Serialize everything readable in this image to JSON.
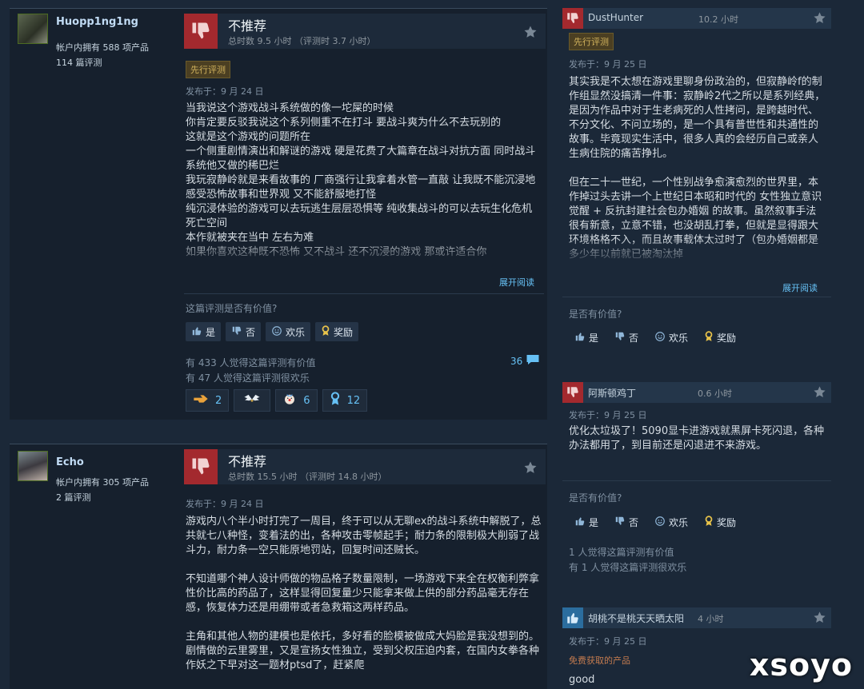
{
  "reviews_left": [
    {
      "author": {
        "name": "Huopp1ng1ng",
        "products": "帐户内拥有 588 项产品",
        "reviews": "114 篇评测"
      },
      "verdict": "不推荐",
      "hours": "总时数 9.5 小时 （评测时 3.7 小时）",
      "badge": "先行评测",
      "posted": "发布于：9 月 24 日",
      "text": "当我说这个游戏战斗系统做的像一坨屎的时候\n你肯定要反驳我说这个系列侧重不在打斗 要战斗爽为什么不去玩别的\n这就是这个游戏的问题所在\n一个侧重剧情演出和解谜的游戏 硬是花费了大篇章在战斗对抗方面 同时战斗系统他又做的稀巴烂\n我玩寂静岭就是来看故事的 厂商强行让我拿着水管一直敲 让我既不能沉浸地感受恐怖故事和世界观 又不能舒服地打怪\n纯沉浸体验的游戏可以去玩逃生层层恐惧等 纯收集战斗的可以去玩生化危机死亡空间\n本作就被夹在当中 左右为难\n如果你喜欢这种既不恐怖 又不战斗 还不沉浸的游戏 那或许适合你",
      "read_more": "展开阅读",
      "helpful_q": "这篇评测是否有价值?",
      "btn_yes": "是",
      "btn_no": "否",
      "btn_funny": "欢乐",
      "btn_award": "奖励",
      "stat_helpful": "有 433 人觉得这篇评测有价值",
      "stat_funny": "有 47 人觉得这篇评测很欢乐",
      "comments": "36",
      "awards": [
        {
          "icon": "hand-point-icon",
          "count": "2"
        },
        {
          "icon": "wings-icon",
          "count": ""
        },
        {
          "icon": "clown-face-icon",
          "count": "6"
        },
        {
          "icon": "ribbon-medal-icon",
          "count": "12"
        }
      ]
    },
    {
      "author": {
        "name": "Echo",
        "products": "帐户内拥有 305 项产品",
        "reviews": "2 篇评测"
      },
      "verdict": "不推荐",
      "hours": "总时数 15.5 小时 （评测时 14.8 小时）",
      "posted": "发布于：9 月 24 日",
      "text": "游戏内八个半小时打完了一周目，终于可以从无聊ex的战斗系统中解脱了，总共就七八种怪，变着法的出，各种攻击零帧起手；耐力条的限制极大削弱了战斗力，耐力条一空只能原地罚站，回复时间还贼长。\n\n不知道哪个神人设计师做的物品格子数量限制，一场游戏下来全在权衡利弊拿性价比高的药品了，这样显得回复量少只能拿来做上供的部分药品毫无存在感，恢复体力还是用绷带或者急救箱这两样药品。\n\n主角和其他人物的建模也是依托，多好看的脸模被做成大妈脸是我没想到的。剧情做的云里雾里，又是宣扬女性独立，受到父权压迫内套，在国内女拳各种作妖之下早对这一题材ptsd了，赶紧爬"
    }
  ],
  "reviews_right": [
    {
      "name": "DustHunter",
      "hours": "10.2 小时",
      "badge": "先行评测",
      "posted": "发布于：9 月 25 日",
      "text": "其实我是不太想在游戏里聊身份政治的，但寂静岭f的制作组显然没搞清一件事：寂静岭2代之所以是系列经典，是因为作品中对于生老病死的人性拷问，是跨越时代、不分文化、不问立场的，是一个具有普世性和共通性的故事。毕竟现实生活中，很多人真的会经历自己或亲人生病住院的痛苦挣扎。\n\n但在二十一世纪，一个性别战争愈演愈烈的世界里，本作掉过头去讲一个上世纪日本昭和时代的 女性独立意识觉醒 + 反抗封建社会包办婚姻 的故事。虽然叙事手法很有新意，立意不错，也没胡乱打拳，但就是显得跟大环境格格不入，而且故事载体太过时了（包办婚姻都是多少年以前就已被淘汰掉",
      "read_more": "展开阅读",
      "helpful_q": "是否有价值?",
      "btn_yes": "是",
      "btn_no": "否",
      "btn_funny": "欢乐",
      "btn_award": "奖励"
    },
    {
      "name": "阿斯顿鸡丁",
      "hours": "0.6 小时",
      "posted": "发布于：9 月 25 日",
      "text": "优化太垃圾了！5090显卡进游戏就黑屏卡死闪退，各种办法都用了，到目前还是闪退进不来游戏。",
      "helpful_q": "是否有价值?",
      "btn_yes": "是",
      "btn_no": "否",
      "btn_funny": "欢乐",
      "btn_award": "奖励",
      "stat_helpful": "1 人觉得这篇评测有价值",
      "stat_funny": "有 1 人觉得这篇评测很欢乐"
    },
    {
      "name": "胡桃不是桃天天晒太阳",
      "hours": "4 小时",
      "posted": "发布于：9 月 25 日",
      "free": "免费获取的产品",
      "text": "good"
    }
  ],
  "watermark": "xsoyo",
  "colors": {
    "negative": "#a3292e",
    "positive": "#2b6d9e",
    "link": "#66c0f4",
    "badge": "#d2b35d"
  }
}
